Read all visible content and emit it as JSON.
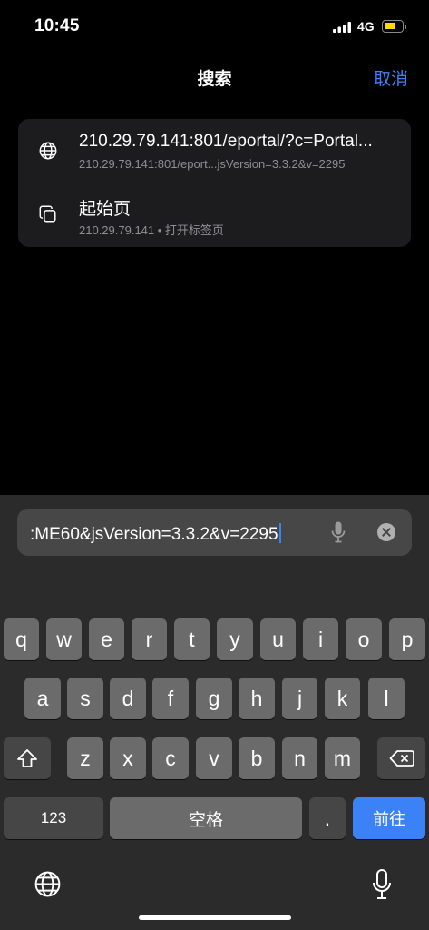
{
  "status_bar": {
    "time": "10:45",
    "network": "4G"
  },
  "header": {
    "title": "搜索",
    "cancel_label": "取消"
  },
  "suggestions": [
    {
      "title": "210.29.79.141:801/eportal/?c=Portal...",
      "subtitle": "210.29.79.141:801/eport...jsVersion=3.3.2&v=2295",
      "icon": "globe-icon"
    },
    {
      "title": "起始页",
      "subtitle": "210.29.79.141 • 打开标签页",
      "icon": "tabs-icon"
    }
  ],
  "address_bar": {
    "value": ":ME60&jsVersion=3.3.2&v=2295"
  },
  "keyboard": {
    "row1": [
      "q",
      "w",
      "e",
      "r",
      "t",
      "y",
      "u",
      "i",
      "o",
      "p"
    ],
    "row2": [
      "a",
      "s",
      "d",
      "f",
      "g",
      "h",
      "j",
      "k",
      "l"
    ],
    "row3": [
      "z",
      "x",
      "c",
      "v",
      "b",
      "n",
      "m"
    ],
    "numbers_label": "123",
    "space_label": "空格",
    "period_label": ".",
    "go_label": "前往"
  },
  "colors": {
    "accent": "#3b82f6",
    "background": "#000000",
    "keyboard_bg": "#2b2b2b",
    "key": "#6b6b6b",
    "key_dark": "#464646",
    "battery": "#ffd60a"
  }
}
